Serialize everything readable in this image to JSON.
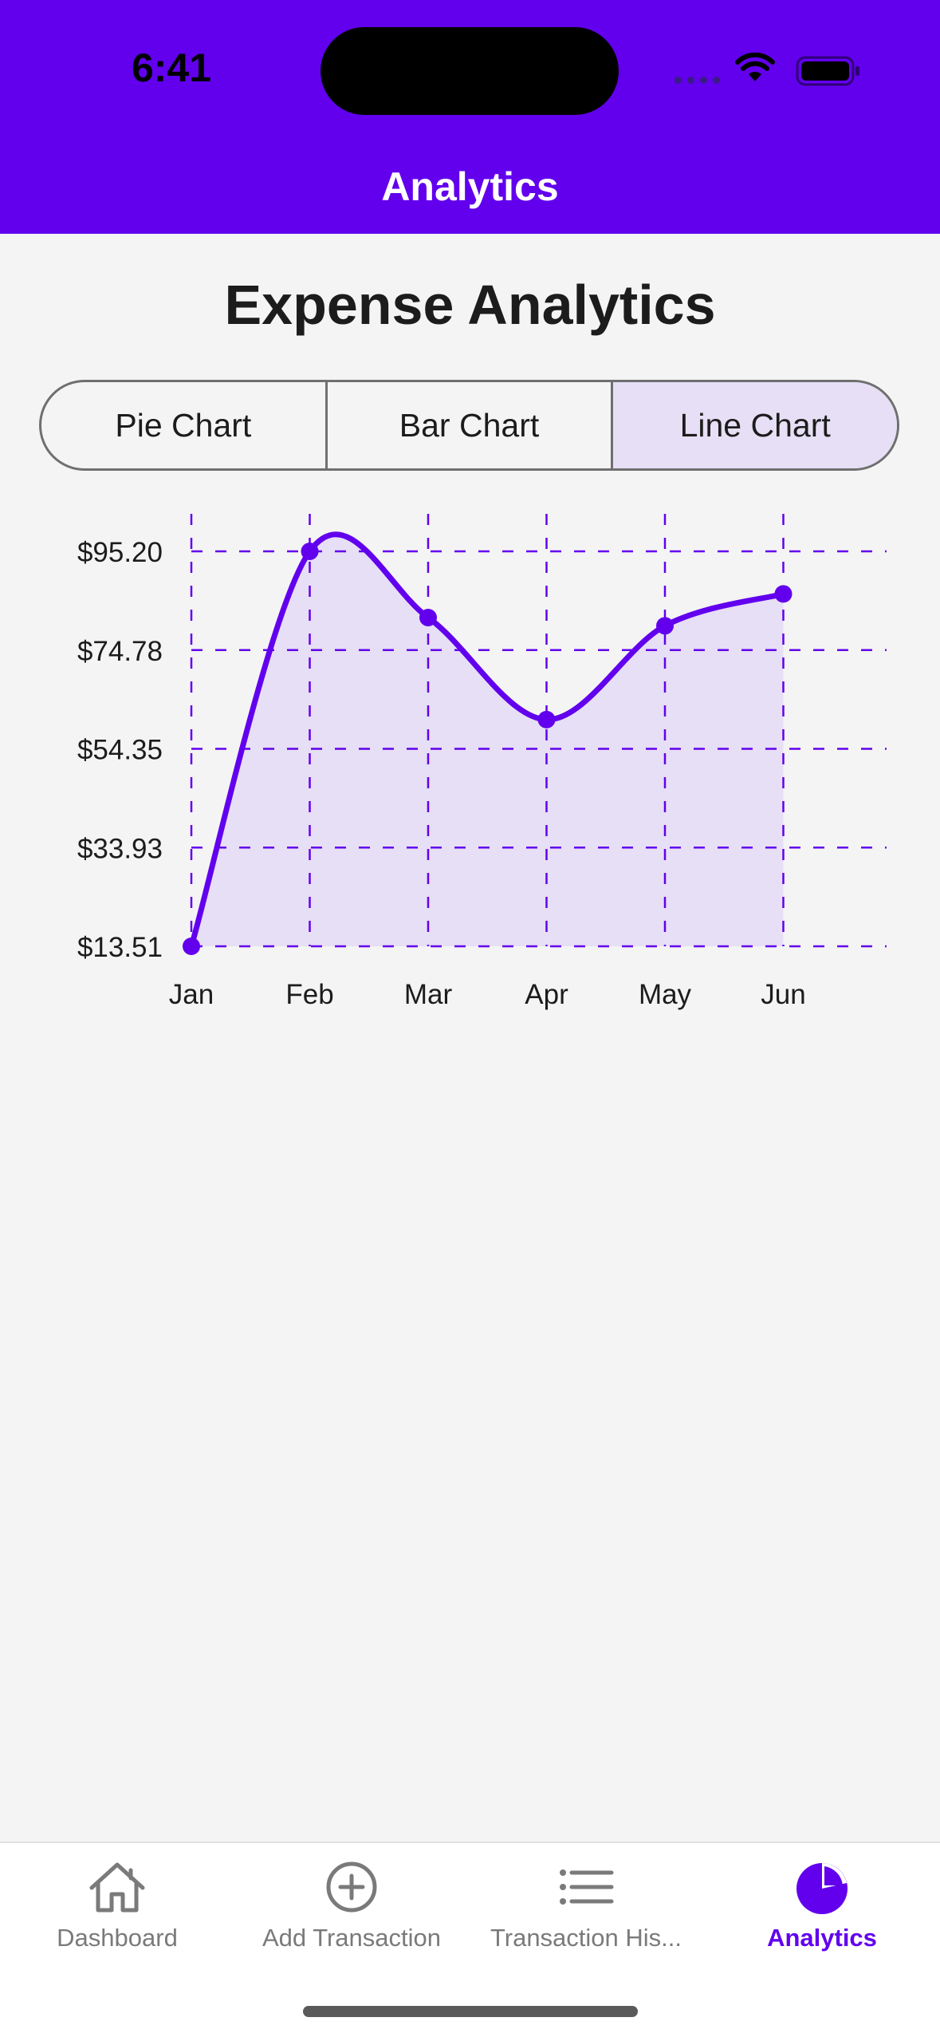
{
  "status_bar": {
    "time": "6:41",
    "icons": [
      "signal-icon",
      "wifi-icon",
      "battery-icon"
    ]
  },
  "header": {
    "title": "Analytics"
  },
  "page": {
    "title": "Expense Analytics"
  },
  "chart_tabs": [
    {
      "label": "Pie Chart",
      "active": false
    },
    {
      "label": "Bar Chart",
      "active": false
    },
    {
      "label": "Line Chart",
      "active": true
    }
  ],
  "chart_data": {
    "type": "line",
    "categories": [
      "Jan",
      "Feb",
      "Mar",
      "Apr",
      "May",
      "Jun"
    ],
    "series": [
      {
        "values": [
          13.51,
          95.2,
          81.5,
          60.4,
          79.8,
          86.4
        ]
      }
    ],
    "y_ticks": [
      "$13.51",
      "$33.93",
      "$54.35",
      "$74.78",
      "$95.20"
    ],
    "ylim": [
      13.51,
      95.2
    ],
    "grid": true,
    "colors": {
      "line": "#6200ee",
      "fill": "#e6dff5",
      "grid": "#6200ee"
    }
  },
  "tab_bar": [
    {
      "label": "Dashboard",
      "icon": "house-icon",
      "active": false
    },
    {
      "label": "Add Transaction",
      "icon": "plus-circle-icon",
      "active": false
    },
    {
      "label": "Transaction His...",
      "icon": "list-icon",
      "active": false
    },
    {
      "label": "Analytics",
      "icon": "pie-chart-icon",
      "active": true
    }
  ],
  "colors": {
    "accent": "#6200ee",
    "background": "#f4f4f4",
    "inactive": "#7a7a7a"
  }
}
